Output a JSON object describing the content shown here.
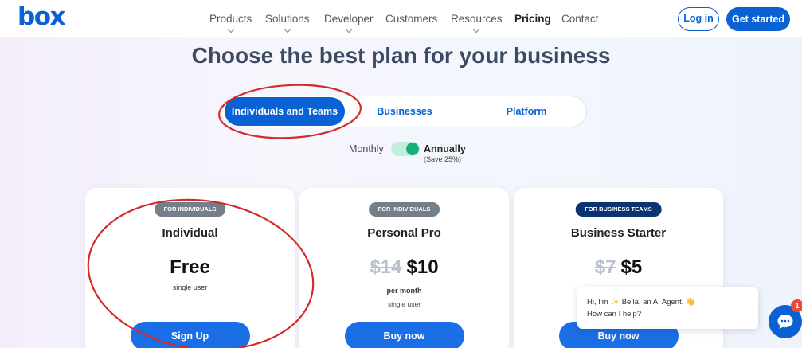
{
  "brand": {
    "logo_text": "box",
    "color": "#0a61d4"
  },
  "nav": {
    "items": [
      {
        "label": "Products",
        "has_dropdown": true
      },
      {
        "label": "Solutions",
        "has_dropdown": true
      },
      {
        "label": "Developer",
        "has_dropdown": true
      },
      {
        "label": "Customers",
        "has_dropdown": false
      },
      {
        "label": "Resources",
        "has_dropdown": true
      },
      {
        "label": "Pricing",
        "has_dropdown": false,
        "active": true
      },
      {
        "label": "Contact",
        "has_dropdown": false
      }
    ],
    "login_label": "Log in",
    "get_started_label": "Get started"
  },
  "page": {
    "title": "Choose the best plan for your business"
  },
  "tabs": [
    {
      "label": "Individuals and Teams",
      "selected": true
    },
    {
      "label": "Businesses",
      "selected": false
    },
    {
      "label": "Platform",
      "selected": false
    }
  ],
  "billing": {
    "monthly_label": "Monthly",
    "annual_label": "Annually",
    "annual_note": "(Save 25%)",
    "selected": "Annually"
  },
  "plans": [
    {
      "badge": "FOR INDIVIDUALS",
      "name": "Individual",
      "price": "Free",
      "old_price": "",
      "period": "",
      "note": "single user",
      "button": "Sign Up"
    },
    {
      "badge": "FOR INDIVIDUALS",
      "name": "Personal Pro",
      "old_price": "$14",
      "price": "$10",
      "period": "per month",
      "note": "single user",
      "button": "Buy now"
    },
    {
      "badge": "FOR BUSINESS TEAMS",
      "name": "Business Starter",
      "old_price": "$7",
      "price": "$5",
      "period": "",
      "note": "",
      "button": "Buy now"
    }
  ],
  "chat": {
    "line1": "Hi, I'm ✨ Bella, an AI Agent. 👋",
    "line2": "How can I help?",
    "notification_count": "1"
  },
  "colors": {
    "primary": "#0a61d4",
    "button": "#1a6fe6",
    "toggle_on": "#18b07a",
    "badge_gray": "#757f8a",
    "badge_dark": "#0c3471",
    "annotation_red": "#d42a2a"
  }
}
